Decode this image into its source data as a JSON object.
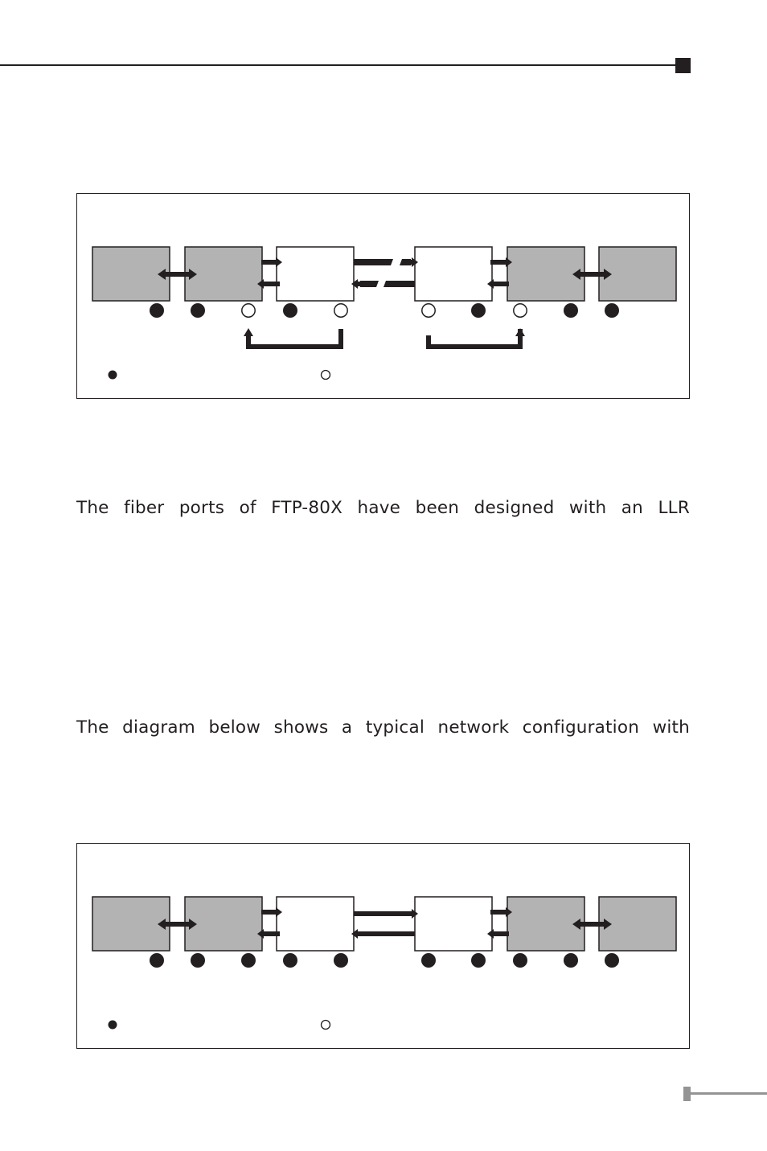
{
  "page": {
    "colors": {
      "ink": "#231f20",
      "device_fill": "#b3b3b3",
      "converter_fill": "#ffffff",
      "footer_gray": "#949494"
    }
  },
  "diagram_1": {
    "state": "link-fault",
    "fiber_link_style": "broken",
    "devices": [
      {
        "role": "end-device",
        "fill": "gray"
      },
      {
        "role": "switch",
        "fill": "gray"
      },
      {
        "role": "converter",
        "fill": "white"
      },
      {
        "role": "converter",
        "fill": "white"
      },
      {
        "role": "switch",
        "fill": "gray"
      },
      {
        "role": "end-device",
        "fill": "gray"
      }
    ],
    "leds": [
      "on",
      "on",
      "off",
      "on",
      "off",
      "off",
      "on",
      "off",
      "on",
      "on"
    ],
    "loopback_arrows": [
      {
        "from_led": 4,
        "to_led": 2,
        "direction": "up"
      },
      {
        "from_led": 5,
        "to_led": 7,
        "direction": "up"
      }
    ],
    "legend": [
      {
        "symbol": "led-on-icon",
        "state": "on"
      },
      {
        "symbol": "led-off-icon",
        "state": "off"
      }
    ]
  },
  "paragraph_1": {
    "text": "The fiber ports of FTP-80X have been designed with an LLR"
  },
  "paragraph_2": {
    "text": "The diagram below shows a typical network configuration with"
  },
  "diagram_2": {
    "state": "normal",
    "fiber_link_style": "solid",
    "devices": [
      {
        "role": "end-device",
        "fill": "gray"
      },
      {
        "role": "switch",
        "fill": "gray"
      },
      {
        "role": "converter",
        "fill": "white"
      },
      {
        "role": "converter",
        "fill": "white"
      },
      {
        "role": "switch",
        "fill": "gray"
      },
      {
        "role": "end-device",
        "fill": "gray"
      }
    ],
    "leds": [
      "on",
      "on",
      "on",
      "on",
      "on",
      "on",
      "on",
      "on",
      "on",
      "on"
    ],
    "loopback_arrows": [],
    "legend": [
      {
        "symbol": "led-on-icon",
        "state": "on"
      },
      {
        "symbol": "led-off-icon",
        "state": "off"
      }
    ]
  }
}
